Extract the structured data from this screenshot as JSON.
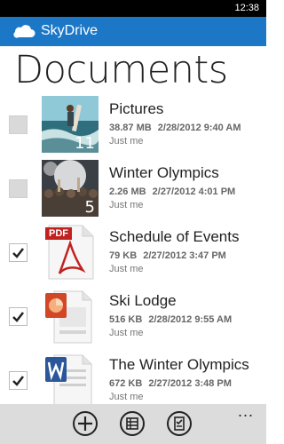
{
  "status": {
    "time": "12:38"
  },
  "app": {
    "name": "SkyDrive"
  },
  "page": {
    "title": "Documents"
  },
  "items": [
    {
      "name": "Pictures",
      "size": "38.87 MB",
      "date": "2/28/2012 9:40 AM",
      "owner": "Just me",
      "count": "11",
      "checked": false,
      "icon": "photo-surfer"
    },
    {
      "name": "Winter Olympics",
      "size": "2.26 MB",
      "date": "2/27/2012 4:01 PM",
      "owner": "Just me",
      "count": "5",
      "checked": false,
      "icon": "photo-crowd"
    },
    {
      "name": "Schedule of Events",
      "size": "79 KB",
      "date": "2/27/2012 3:47 PM",
      "owner": "Just me",
      "checked": true,
      "icon": "pdf-file-icon",
      "badge": "PDF"
    },
    {
      "name": "Ski Lodge",
      "size": "516 KB",
      "date": "2/28/2012 9:55 AM",
      "owner": "Just me",
      "checked": true,
      "icon": "powerpoint-file-icon"
    },
    {
      "name": "The Winter Olympics",
      "size": "672 KB",
      "date": "2/27/2012 3:48 PM",
      "owner": "Just me",
      "checked": true,
      "icon": "word-file-icon"
    }
  ],
  "toolbar": {
    "more": "..."
  },
  "colors": {
    "accent": "#1c78c7",
    "pdf": "#c1221f",
    "ppt": "#d24726",
    "word": "#2b579a"
  }
}
